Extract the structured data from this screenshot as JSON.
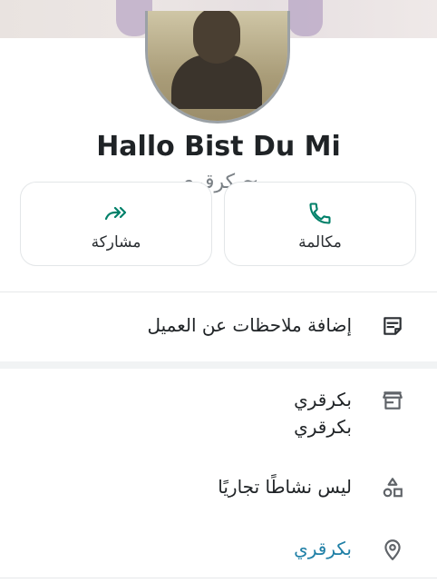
{
  "profile": {
    "name": "Hallo Bist Du Mi",
    "subname": "~بكرقري"
  },
  "actions": [
    {
      "label": "مكالمة",
      "icon": "phone-icon"
    },
    {
      "label": "مشاركة",
      "icon": "share-forward-icon"
    }
  ],
  "notes": {
    "label": "إضافة ملاحظات عن العميل",
    "icon": "note-icon"
  },
  "business": {
    "store_line1": "بكرقري",
    "store_line2": "بكرقري",
    "store_icon": "store-icon",
    "category": "ليس نشاطًا تجاريًا",
    "category_icon": "shapes-icon",
    "location": "بكرقري",
    "location_icon": "location-pin-icon"
  },
  "colors": {
    "accent": "#008069",
    "link": "#1f7fa6",
    "stripe": "#52e89b"
  }
}
